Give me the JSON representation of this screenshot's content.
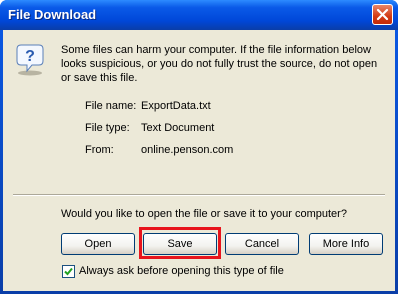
{
  "window": {
    "title": "File Download"
  },
  "message": "Some files can harm your computer. If the file information below looks suspicious, or you do not fully trust the source, do not open or save this file.",
  "details": [
    {
      "label": "File name:",
      "value": "ExportData.txt"
    },
    {
      "label": "File type:",
      "value": "Text Document"
    },
    {
      "label": "From:",
      "value": "online.penson.com"
    }
  ],
  "question": "Would you like to open the file or save it to your computer?",
  "buttons": {
    "open": "Open",
    "save": "Save",
    "cancel": "Cancel",
    "more_info": "More Info"
  },
  "checkbox": {
    "label": "Always ask before opening this type of file",
    "checked": true
  },
  "colors": {
    "titlebar": "#0a5ae8",
    "dialog_bg": "#ece9d8",
    "highlight": "#e8141c",
    "close_button": "#d23a14"
  },
  "icons": {
    "info": "question-shield-icon",
    "close": "close-icon"
  }
}
